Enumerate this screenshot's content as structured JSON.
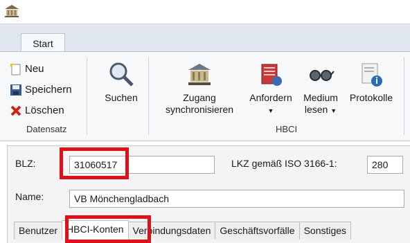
{
  "ribbon": {
    "tab_start": "Start",
    "datensatz": {
      "neu": "Neu",
      "speichern": "Speichern",
      "loeschen": "Löschen",
      "group": "Datensatz"
    },
    "suchen": "Suchen",
    "hbci": {
      "zugang_line1": "Zugang",
      "zugang_line2": "synchronisieren",
      "anfordern": "Anfordern",
      "medium_line1": "Medium",
      "medium_line2": "lesen",
      "protokolle": "Protokolle",
      "group": "HBCI"
    }
  },
  "form": {
    "blz_label": "BLZ:",
    "blz_value": "31060517",
    "lkz_label": "LKZ gemäß ISO 3166-1:",
    "lkz_value": "280",
    "name_label": "Name:",
    "name_value": "VB Mönchengladbach"
  },
  "tabs": [
    "Benutzer",
    "HBCI-Konten",
    "Verbindungsdaten",
    "Geschäftsvorfälle",
    "Sonstiges"
  ],
  "colors": {
    "highlight": "#e0101a",
    "ribbon_bg": "#f7f8fa",
    "tabrow_bg": "#dfe6f0"
  }
}
